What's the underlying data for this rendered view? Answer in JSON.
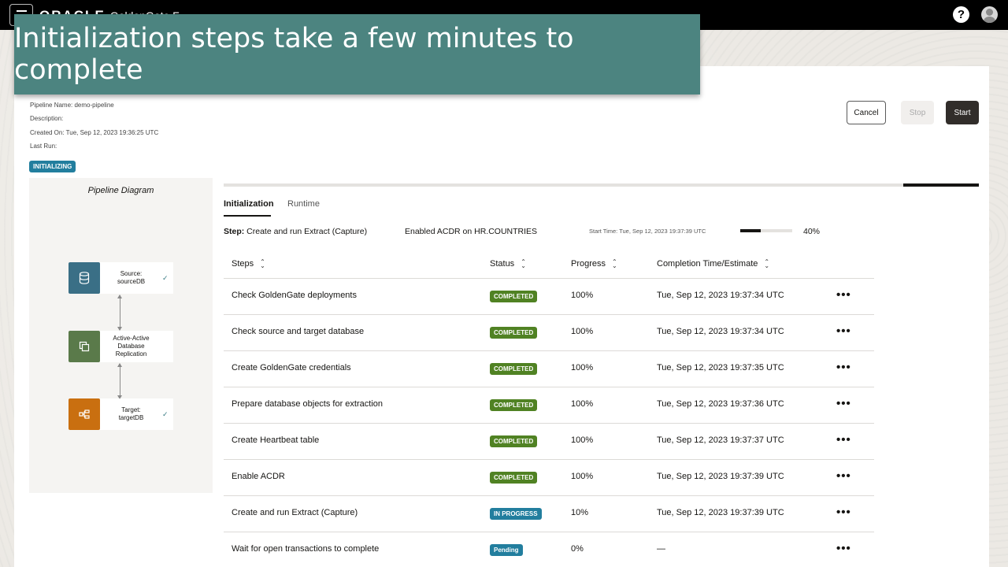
{
  "header": {
    "brand": "ORACLE",
    "product": "GoldenGate F",
    "help_icon": "?"
  },
  "banner": {
    "text": "Initialization steps take a few minutes to complete"
  },
  "pipeline": {
    "name": "Pipeline Name: demo-pipeline",
    "description": "Description:",
    "created_on": "Created On: Tue, Sep 12, 2023 19:36:25 UTC",
    "last_run": "Last Run:",
    "status": "INITIALIZING"
  },
  "actions": {
    "cancel": "Cancel",
    "stop": "Stop",
    "start": "Start"
  },
  "diagram": {
    "title": "Pipeline Diagram",
    "nodes": [
      {
        "label": "Source: sourceDB",
        "line1": "Source:",
        "line2": "sourceDB",
        "check": "✓",
        "color": "#3a6f86",
        "icon": "database-icon"
      },
      {
        "line1": "Active-Active",
        "line2": "Database",
        "line3": "Replication",
        "color": "#5a7a4a",
        "icon": "copy-icon"
      },
      {
        "line1": "Target:",
        "line2": "targetDB",
        "check": "✓",
        "color": "#c96f10",
        "icon": "target-icon"
      }
    ]
  },
  "overall_progress": 0.1,
  "tabs": {
    "initialization": "Initialization",
    "runtime": "Runtime"
  },
  "current": {
    "step_label": "Step:",
    "step_name": "Create and run Extract (Capture)",
    "detail": "Enabled ACDR on HR.COUNTRIES",
    "start_time": "Start Time: Tue, Sep 12, 2023 19:37:39 UTC",
    "progress_value": 0.4,
    "progress_text": "40%"
  },
  "table": {
    "headers": {
      "steps": "Steps",
      "status": "Status",
      "progress": "Progress",
      "completion": "Completion Time/Estimate"
    },
    "rows": [
      {
        "step": "Check GoldenGate deployments",
        "status": "COMPLETED",
        "progress": "100%",
        "time": "Tue, Sep 12, 2023 19:37:34 UTC"
      },
      {
        "step": "Check source and target database",
        "status": "COMPLETED",
        "progress": "100%",
        "time": "Tue, Sep 12, 2023 19:37:34 UTC"
      },
      {
        "step": "Create GoldenGate credentials",
        "status": "COMPLETED",
        "progress": "100%",
        "time": "Tue, Sep 12, 2023 19:37:35 UTC"
      },
      {
        "step": "Prepare database objects for extraction",
        "status": "COMPLETED",
        "progress": "100%",
        "time": "Tue, Sep 12, 2023 19:37:36 UTC"
      },
      {
        "step": "Create Heartbeat table",
        "status": "COMPLETED",
        "progress": "100%",
        "time": "Tue, Sep 12, 2023 19:37:37 UTC"
      },
      {
        "step": "Enable ACDR",
        "status": "COMPLETED",
        "progress": "100%",
        "time": "Tue, Sep 12, 2023 19:37:39 UTC"
      },
      {
        "step": "Create and run Extract (Capture)",
        "status": "IN PROGRESS",
        "progress": "10%",
        "time": "Tue, Sep 12, 2023 19:37:39 UTC"
      },
      {
        "step": "Wait for open transactions to complete",
        "status": "Pending",
        "progress": "0%",
        "time": "—"
      }
    ],
    "more_icon": "•••"
  }
}
